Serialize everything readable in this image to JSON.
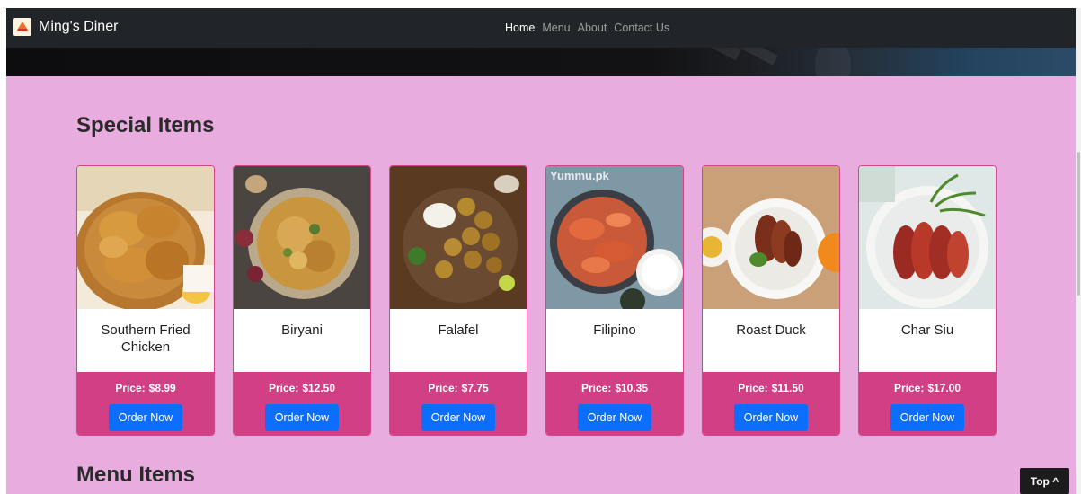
{
  "navbar": {
    "brand": "Ming's Diner",
    "links": [
      {
        "label": "Home",
        "active": true
      },
      {
        "label": "Menu",
        "active": false
      },
      {
        "label": "About",
        "active": false
      },
      {
        "label": "Contact Us",
        "active": false
      }
    ]
  },
  "special": {
    "title": "Special Items",
    "price_prefix": "Price:",
    "order_label": "Order Now",
    "items": [
      {
        "name": "Southern Fried Chicken",
        "price": "$8.99"
      },
      {
        "name": "Biryani",
        "price": "$12.50"
      },
      {
        "name": "Falafel",
        "price": "$7.75"
      },
      {
        "name": "Filipino",
        "price": "$10.35",
        "watermark": "Yummu.pk"
      },
      {
        "name": "Roast Duck",
        "price": "$11.50"
      },
      {
        "name": "Char Siu",
        "price": "$17.00"
      }
    ]
  },
  "menu": {
    "title": "Menu Items"
  },
  "top_button": "Top ^",
  "colors": {
    "page_bg": "#e9acdf",
    "navbar_bg": "#212529",
    "card_footer": "#d13f85",
    "card_border": "#d0458c",
    "button_blue": "#0d6efd"
  }
}
